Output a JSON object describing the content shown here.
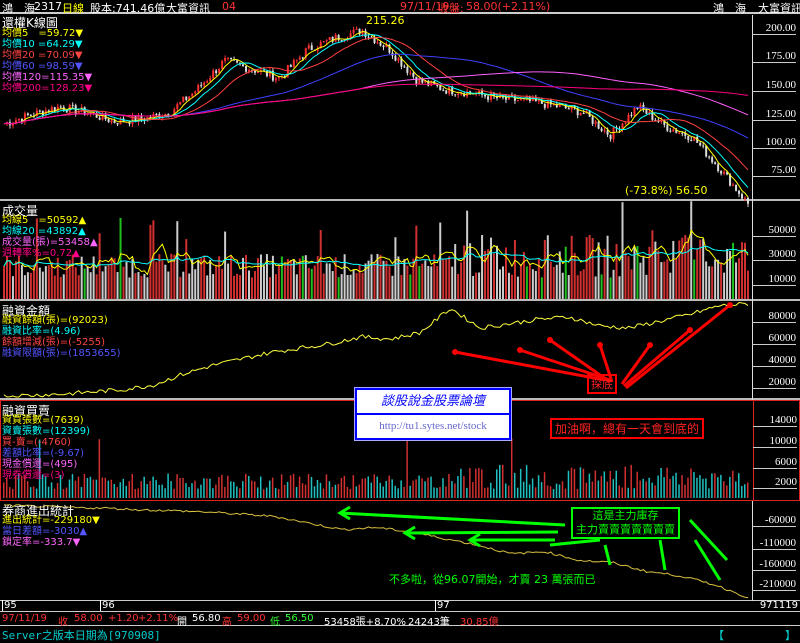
{
  "header": {
    "name": "鴻　海",
    "code": "2317",
    "period": "日線",
    "capital": "股本:741.46億",
    "source": "大富資訊",
    "num": "04",
    "date": "97/11/19",
    "close_label": "收盤:",
    "close": "58.00(+2.11%)",
    "right_name": "鴻　海",
    "right_source": "大富資訊"
  },
  "panels": {
    "price": {
      "title": "還權K線圖",
      "legend": [
        "均價5　=59.72▼",
        "均價10 =64.29▼",
        "均價20 =70.09▼",
        "均價60 =98.59▼",
        "均價120=115.35▼",
        "均價200=128.23▼"
      ],
      "high_label": "215.26",
      "low_label": "(-73.8%) 56.50",
      "ticks": [
        "200.00",
        "175.00",
        "150.00",
        "125.00",
        "100.00",
        "75.00"
      ]
    },
    "volume": {
      "title": "成交量",
      "legend": [
        "均線5　=50592▲",
        "均線20 =43892▲",
        "成交量(張)=53458▲",
        "週轉率%=0.72▲"
      ],
      "ticks": [
        "50000",
        "30000",
        "10000"
      ]
    },
    "margin": {
      "title": "融資金額",
      "legend": [
        "融資餘額(張)=(92023)",
        "融資比率=(4.96)",
        "餘額增減(張)=(-5255)",
        "融資限額(張)=(1853655)"
      ],
      "ticks": [
        "80000",
        "60000",
        "40000",
        "20000"
      ]
    },
    "trade": {
      "title": "融資買賣",
      "legend": [
        "資買張數=(7639)",
        "資賣張數=(12399)",
        "買-賣=(-4760)",
        "差額比率=(-9.67)",
        "現金償還=(495)",
        "現券償還=(3)"
      ],
      "ticks": [
        "14000",
        "10000",
        "6000",
        "2000"
      ]
    },
    "broker": {
      "title": "券商進出統計",
      "legend": [
        "進出統計=-229180▼",
        "當日差額=-3030▲",
        "鎖定率=-333.7▼"
      ],
      "ticks": [
        "-60000",
        "-110000",
        "-160000",
        "-210000"
      ]
    }
  },
  "xaxis": {
    "labels": [
      "95",
      "96",
      "97"
    ],
    "last_date": "971119"
  },
  "info": {
    "date": "97/11/19",
    "close_label": "收",
    "close": "58.00",
    "change": "+1.20",
    "pct": "+2.11%",
    "open_label": "開",
    "open": "56.80",
    "high_label": "高",
    "high": "59.00",
    "low_label": "低",
    "low": "56.50",
    "vol": "53458張+8.70%",
    "trades": "24243筆",
    "amount": "30.85億"
  },
  "status": {
    "text": "Server之版本日期為[970908]",
    "bracket_l": "【",
    "bracket_r": "】"
  },
  "annotations": {
    "forum_title": "談股說金股票論壇",
    "forum_url": "http://tu1.sytes.net/stock",
    "bottom_label": "探底",
    "cheer": "加油啊，總有一天會到底的",
    "inventory1": "這是主力庫存",
    "inventory2": "主力賣賣賣賣賣賣賣",
    "note": "不多啦，從96.07開始，才賣 23 萬張而已"
  },
  "colors": {
    "ma5": "#ffff00",
    "ma10": "#00ffff",
    "ma20": "#ff4040",
    "ma60": "#4040ff",
    "ma120": "#ff60ff",
    "ma200": "#ff0080",
    "red_ann": "#ff0000",
    "green_ann": "#00ff00"
  },
  "chart_data": {
    "type": "line",
    "title": "還權K線圖",
    "price_series": [
      130,
      138,
      145,
      140,
      132,
      134,
      140,
      160,
      185,
      178,
      170,
      195,
      205,
      212,
      195,
      168,
      160,
      157,
      152,
      150,
      146,
      140,
      120,
      145,
      128,
      118,
      90,
      60
    ],
    "price_ylim": [
      60,
      215
    ],
    "margin_series": [
      8000,
      9000,
      10000,
      12000,
      14000,
      18000,
      28000,
      36000,
      42000,
      48000,
      52000,
      56000,
      62000,
      60000,
      66000,
      88000,
      70000,
      74000,
      78000,
      80000,
      72000,
      70000,
      76000,
      82000,
      90000,
      92000
    ],
    "margin_ylim": [
      0,
      95000
    ],
    "broker_series": [
      -20000,
      -22000,
      -25000,
      -26000,
      -30000,
      -32000,
      -35000,
      -40000,
      -45000,
      -60000,
      -75000,
      -70000,
      -80000,
      -95000,
      -110000,
      -130000,
      -125000,
      -145000,
      -150000,
      -170000,
      -180000,
      -200000,
      -229180
    ],
    "broker_ylim": [
      -240000,
      -10000
    ]
  }
}
